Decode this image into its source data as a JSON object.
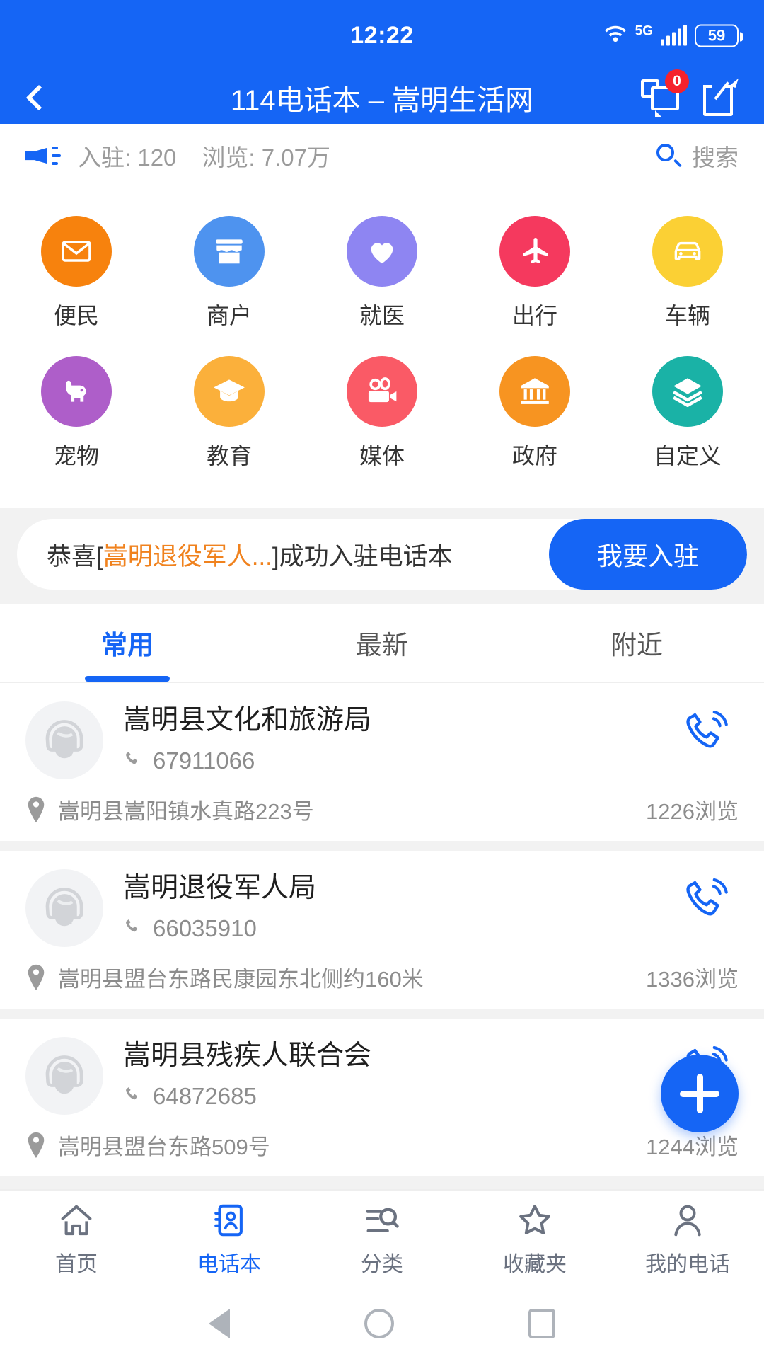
{
  "status_bar": {
    "time": "12:22",
    "network_label": "5G",
    "battery": "59",
    "wifi_icon": "wifi-icon",
    "signal_icon": "signal-bars-icon",
    "battery_icon": "battery-icon"
  },
  "app_bar": {
    "title": "114电话本 – 嵩明生活网",
    "back_icon": "back-chevron-icon",
    "chat_icon": "chat-bubble-icon",
    "chat_badge": "0",
    "share_icon": "share-icon"
  },
  "stats": {
    "horn_icon": "megaphone-icon",
    "enrolled": "入驻: 120",
    "views": "浏览: 7.07万",
    "search_icon": "search-icon",
    "search_label": "搜索"
  },
  "categories": [
    {
      "label": "便民",
      "icon": "envelope-icon",
      "color": "#f7820d"
    },
    {
      "label": "商户",
      "icon": "storefront-icon",
      "color": "#4e93ef"
    },
    {
      "label": "就医",
      "icon": "heart-icon",
      "color": "#8e85f2"
    },
    {
      "label": "出行",
      "icon": "airplane-icon",
      "color": "#f5395e"
    },
    {
      "label": "车辆",
      "icon": "car-icon",
      "color": "#fbd034"
    },
    {
      "label": "宠物",
      "icon": "dog-icon",
      "color": "#ae5ec9"
    },
    {
      "label": "教育",
      "icon": "graduation-cap-icon",
      "color": "#fbb03b"
    },
    {
      "label": "媒体",
      "icon": "video-camera-icon",
      "color": "#fa5a66"
    },
    {
      "label": "政府",
      "icon": "bank-icon",
      "color": "#f79421"
    },
    {
      "label": "自定义",
      "icon": "layers-icon",
      "color": "#1ab2a6"
    }
  ],
  "banner": {
    "prefix": "恭喜[",
    "highlight": "嵩明退役军人...",
    "suffix": "]成功入驻电话本",
    "button_label": "我要入驻",
    "accent_color": "#f0821e",
    "button_color": "#1565f5"
  },
  "tabs": [
    {
      "label": "常用",
      "active": true
    },
    {
      "label": "最新",
      "active": false
    },
    {
      "label": "附近",
      "active": false
    }
  ],
  "list": [
    {
      "name": "嵩明县文化和旅游局",
      "phone": "67911066",
      "address": "嵩明县嵩阳镇水真路223号",
      "views": "1226浏览",
      "avatar_icon": "headset-operator-icon",
      "call_icon": "phone-ring-icon",
      "pin_icon": "map-pin-icon",
      "phone_icon": "phone-handset-icon"
    },
    {
      "name": "嵩明退役军人局",
      "phone": "66035910",
      "address": "嵩明县盟台东路民康园东北侧约160米",
      "views": "1336浏览",
      "avatar_icon": "headset-operator-icon",
      "call_icon": "phone-ring-icon",
      "pin_icon": "map-pin-icon",
      "phone_icon": "phone-handset-icon"
    },
    {
      "name": "嵩明县残疾人联合会",
      "phone": "64872685",
      "address": "嵩明县盟台东路509号",
      "views": "1244浏览",
      "avatar_icon": "headset-operator-icon",
      "call_icon": "phone-ring-icon",
      "pin_icon": "map-pin-icon",
      "phone_icon": "phone-handset-icon"
    }
  ],
  "fab": {
    "icon": "plus-icon",
    "color": "#1565f5"
  },
  "bottom_nav": [
    {
      "label": "首页",
      "icon": "home-icon",
      "active": false
    },
    {
      "label": "电话本",
      "icon": "contacts-icon",
      "active": true
    },
    {
      "label": "分类",
      "icon": "category-search-icon",
      "active": false
    },
    {
      "label": "收藏夹",
      "icon": "star-icon",
      "active": false
    },
    {
      "label": "我的电话",
      "icon": "person-icon",
      "active": false
    }
  ],
  "system_nav": {
    "back_icon": "system-back-icon",
    "home_icon": "system-home-icon",
    "recents_icon": "system-recents-icon"
  }
}
